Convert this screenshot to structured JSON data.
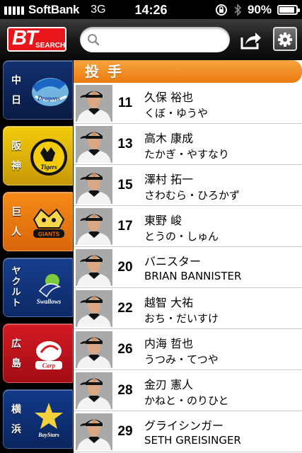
{
  "status_bar": {
    "carrier": "SoftBank",
    "network": "3G",
    "time": "14:26",
    "battery_percent": "90%",
    "battery_level": 0.9,
    "icons": [
      "signal-icon",
      "rotation-lock-icon",
      "bluetooth-icon",
      "battery-icon"
    ]
  },
  "header": {
    "logo_big": "BT",
    "logo_small": "SEARCH",
    "search_placeholder": "",
    "search_icon": "search-icon",
    "share_icon": "share-icon",
    "settings_icon": "gear-icon"
  },
  "sidebar": {
    "teams": [
      {
        "label": [
          "中",
          "日"
        ],
        "logo_text": "Dragons",
        "colors": [
          "#11306f",
          "#0a1b45"
        ]
      },
      {
        "label": [
          "阪",
          "神"
        ],
        "logo_text": "Tigers",
        "colors": [
          "#f2cc0c",
          "#c89807"
        ]
      },
      {
        "label": [
          "巨",
          "人"
        ],
        "logo_text": "GIANTS",
        "colors": [
          "#f58a17",
          "#d9660a"
        ]
      },
      {
        "label": [
          "ヤ",
          "ク",
          "ル",
          "ト"
        ],
        "logo_text": "Swallows",
        "colors": [
          "#173d8c",
          "#0c2a67"
        ]
      },
      {
        "label": [
          "広",
          "島"
        ],
        "logo_text": "Carp",
        "colors": [
          "#d41a23",
          "#a10c14"
        ]
      },
      {
        "label": [
          "横",
          "浜"
        ],
        "logo_text": "BayStars",
        "colors": [
          "#123a8a",
          "#0a255e"
        ]
      }
    ]
  },
  "section": {
    "title": "投手"
  },
  "players": [
    {
      "number": "11",
      "name": "久保 裕也",
      "kana": "くぼ・ゆうや"
    },
    {
      "number": "13",
      "name": "高木 康成",
      "kana": "たかぎ・やすなり"
    },
    {
      "number": "15",
      "name": "澤村 拓一",
      "kana": "さわむら・ひろかず"
    },
    {
      "number": "17",
      "name": "東野 峻",
      "kana": "とうの・しゅん"
    },
    {
      "number": "20",
      "name": "バニスター",
      "kana": "BRIAN BANNISTER"
    },
    {
      "number": "22",
      "name": "越智 大祐",
      "kana": "おち・だいすけ"
    },
    {
      "number": "26",
      "name": "内海 哲也",
      "kana": "うつみ・てつや"
    },
    {
      "number": "28",
      "name": "金刃 憲人",
      "kana": "かねと・のりひと"
    },
    {
      "number": "29",
      "name": "グライシンガー",
      "kana": "SETH GREISINGER"
    }
  ],
  "colors": {
    "accent_orange": "#ef8a1c",
    "logo_red": "#e8151b",
    "giants_orange": "#f06c00"
  }
}
